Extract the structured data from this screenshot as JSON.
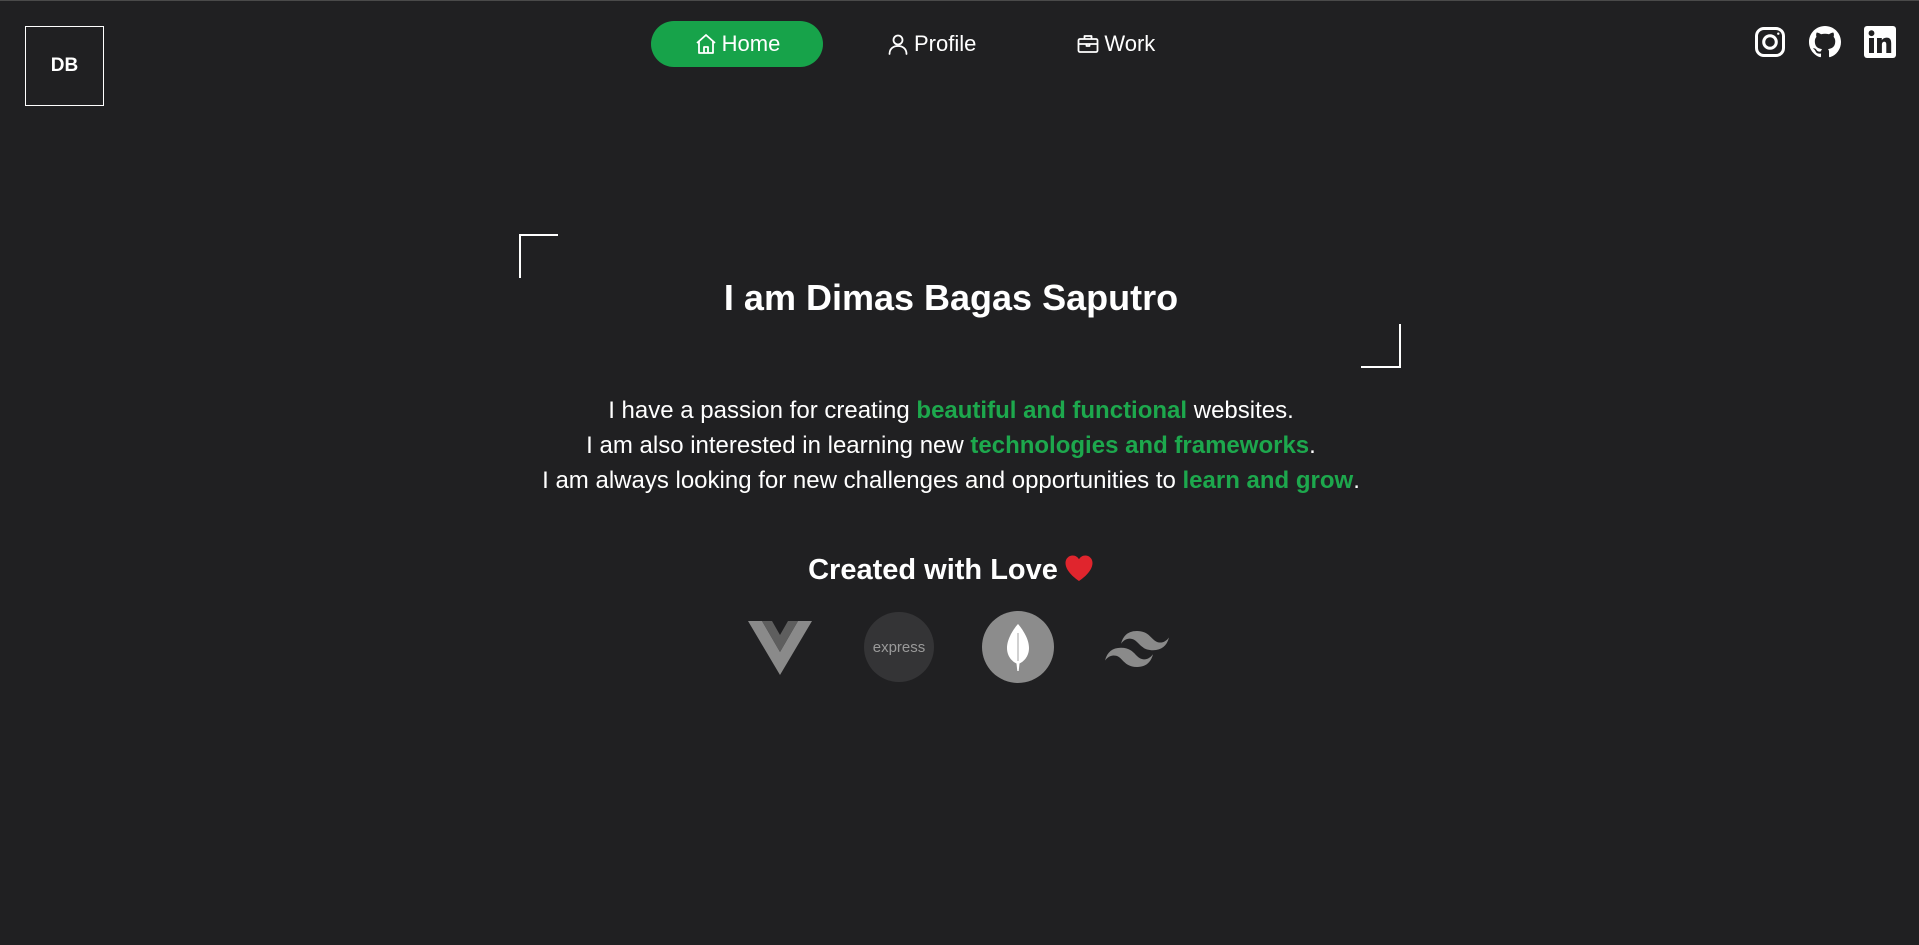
{
  "logo": {
    "text": "DB"
  },
  "nav": {
    "items": [
      {
        "label": "Home",
        "icon": "home-icon",
        "active": true
      },
      {
        "label": "Profile",
        "icon": "user-icon",
        "active": false
      },
      {
        "label": "Work",
        "icon": "briefcase-icon",
        "active": false
      }
    ]
  },
  "socials": [
    {
      "icon": "instagram-icon"
    },
    {
      "icon": "github-icon"
    },
    {
      "icon": "linkedin-icon"
    }
  ],
  "hero": {
    "title": "I am Dimas Bagas Saputro",
    "lines": [
      {
        "before": "I have a passion for creating ",
        "highlight": "beautiful and functional",
        "after": " websites."
      },
      {
        "before": "I am also interested in learning new ",
        "highlight": "technologies and frameworks",
        "after": "."
      },
      {
        "before": "I am always looking for new challenges and opportunities to ",
        "highlight": "learn and grow",
        "after": "."
      }
    ]
  },
  "created": {
    "text": "Created with Love",
    "icon": "heart-icon"
  },
  "tech_stack": [
    {
      "icon": "vue-icon"
    },
    {
      "icon": "express-icon",
      "text": "express"
    },
    {
      "icon": "mongodb-icon"
    },
    {
      "icon": "tailwind-icon"
    }
  ],
  "colors": {
    "background": "#202022",
    "accent": "#17a34a",
    "highlight": "#1da84d",
    "heart": "#e0252d"
  }
}
